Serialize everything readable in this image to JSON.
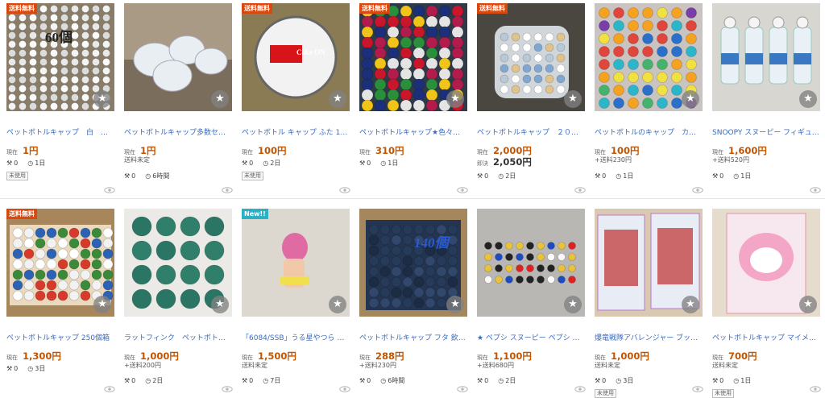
{
  "labels": {
    "current": "現在",
    "buy_now": "即決"
  },
  "icons": {
    "favorite": "star-icon",
    "bids": "gavel-icon",
    "time": "clock-icon",
    "watch": "eye-icon"
  },
  "colors": {
    "title_link": "#3a6bbf",
    "price": "#c45500",
    "free_shipping_badge": "#d9480f",
    "new_badge": "#2bb0c4"
  },
  "rows": [
    {
      "items": [
        {
          "badge": "送料無料",
          "image_text": "60個",
          "image_caption": "",
          "title": "ペットボトルキャップ　白　十…",
          "price": "1円",
          "buy_now": "",
          "shipping": "",
          "bids": "0",
          "time": "1日",
          "condition": "未使用"
        },
        {
          "badge": "",
          "image_text": "",
          "image_caption": "",
          "title": "ペットボトルキャップ多数セッ…",
          "price": "1円",
          "buy_now": "",
          "shipping": "送料未定",
          "bids": "0",
          "time": "6時間",
          "condition": ""
        },
        {
          "badge": "送料無料",
          "image_text": "Coke ON",
          "image_caption": "",
          "title": "ペットボトル キャップ ふた 1個…",
          "price": "100円",
          "buy_now": "",
          "shipping": "",
          "bids": "0",
          "time": "2日",
          "condition": "未使用"
        },
        {
          "badge": "送料無料",
          "image_text": "",
          "image_caption": "",
          "title": "ペットボトルキャップ★色々系…",
          "price": "310円",
          "buy_now": "",
          "shipping": "",
          "bids": "0",
          "time": "1日",
          "condition": ""
        },
        {
          "badge": "送料無料",
          "image_text": "",
          "image_caption": "",
          "title": "ペットボトルキャップ　２０リ…",
          "price": "2,000円",
          "buy_now": "2,050円",
          "shipping": "",
          "bids": "0",
          "time": "2日",
          "condition": ""
        },
        {
          "badge": "",
          "image_text": "",
          "image_caption": "",
          "title": "ペットボトルのキャップ　カラ…",
          "price": "100円",
          "buy_now": "",
          "shipping": "+送料230円",
          "bids": "0",
          "time": "1日",
          "condition": ""
        },
        {
          "badge": "",
          "image_text": "",
          "image_caption": "",
          "title": "SNOOPY スヌーピー フィギュア…",
          "price": "1,600円",
          "buy_now": "",
          "shipping": "+送料520円",
          "bids": "0",
          "time": "1日",
          "condition": ""
        }
      ]
    },
    {
      "items": [
        {
          "badge": "送料無料",
          "image_text": "",
          "image_caption": "",
          "title": "ペットボトルキャップ 250個箱",
          "price": "1,300円",
          "buy_now": "",
          "shipping": "",
          "bids": "0",
          "time": "3日",
          "condition": ""
        },
        {
          "badge": "",
          "image_text": "",
          "image_caption": "",
          "title": "ラットフィンク　ペットボトル…",
          "price": "1,000円",
          "buy_now": "",
          "shipping": "+送料200円",
          "bids": "0",
          "time": "2日",
          "condition": ""
        },
        {
          "badge": "New!!",
          "image_text": "",
          "image_caption": "",
          "title": "「6084/SSB」うる星やつら ラ…",
          "price": "1,500円",
          "buy_now": "",
          "shipping": "送料未定",
          "bids": "0",
          "time": "7日",
          "condition": ""
        },
        {
          "badge": "",
          "image_text": "140個",
          "image_caption": "",
          "title": "ペットボトルキャップ フタ 飲む…",
          "price": "288円",
          "buy_now": "",
          "shipping": "+送料230円",
          "bids": "0",
          "time": "6時間",
          "condition": ""
        },
        {
          "badge": "",
          "image_text": "",
          "image_caption": "",
          "title": "★ ペプシ スヌーピー ペプシ ペ…",
          "price": "1,100円",
          "buy_now": "",
          "shipping": "+送料680円",
          "bids": "0",
          "time": "2日",
          "condition": ""
        },
        {
          "badge": "",
          "image_text": "",
          "image_caption": "",
          "title": "爆竜戦隊アバレンジャー ブッシ…",
          "price": "1,000円",
          "buy_now": "",
          "shipping": "送料未定",
          "bids": "0",
          "time": "3日",
          "condition": "未使用"
        },
        {
          "badge": "",
          "image_text": "",
          "image_caption": "",
          "title": "ペットボトルキャップ マイメロ…",
          "price": "700円",
          "buy_now": "",
          "shipping": "送料未定",
          "bids": "0",
          "time": "1日",
          "condition": "未使用"
        }
      ]
    }
  ]
}
